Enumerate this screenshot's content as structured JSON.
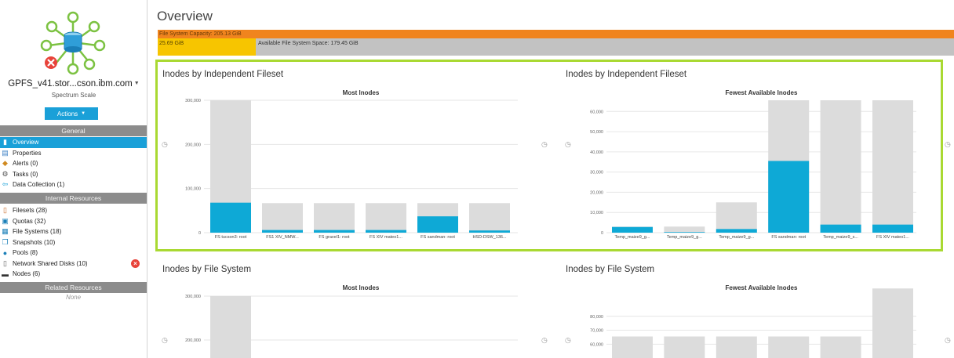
{
  "sidebar": {
    "fs_name": "GPFS_v41.stor...cson.ibm.com",
    "fs_type": "Spectrum Scale",
    "actions_label": "Actions",
    "general_header": "General",
    "general_items": [
      {
        "label": "Overview",
        "icon": "overview-icon"
      },
      {
        "label": "Properties",
        "icon": "properties-icon"
      },
      {
        "label": "Alerts (0)",
        "icon": "alerts-icon"
      },
      {
        "label": "Tasks (0)",
        "icon": "tasks-icon"
      },
      {
        "label": "Data Collection (1)",
        "icon": "data-collection-icon"
      }
    ],
    "internal_header": "Internal Resources",
    "internal_items": [
      {
        "label": "Filesets (28)",
        "icon": "filesets-icon"
      },
      {
        "label": "Quotas (32)",
        "icon": "quotas-icon"
      },
      {
        "label": "File Systems (18)",
        "icon": "file-systems-icon"
      },
      {
        "label": "Snapshots (10)",
        "icon": "snapshots-icon"
      },
      {
        "label": "Pools (8)",
        "icon": "pools-icon"
      },
      {
        "label": "Network Shared Disks (10)",
        "icon": "nsd-icon"
      },
      {
        "label": "Nodes (6)",
        "icon": "nodes-icon"
      }
    ],
    "related_header": "Related Resources",
    "related_none": "None"
  },
  "main": {
    "title": "Overview",
    "capacity_label": "File System Capacity: 205.13 GiB",
    "used_label": "25.69 GiB",
    "available_label": "Available File System Space: 179.45 GiB"
  },
  "colors": {
    "accent": "#1aa0d8",
    "capacity": "#f0841e",
    "used": "#f7c500",
    "available": "#c2c2c2",
    "highlight": "#a9d932",
    "bar_total": "#dcdcdc",
    "bar_used": "#0ea9d6"
  },
  "chart_titles": {
    "c1": "Inodes by Independent Fileset",
    "c2": "Inodes by Independent Fileset",
    "c3": "Inodes by File System",
    "c4": "Inodes by File System"
  },
  "chart_data": [
    {
      "id": "c1",
      "type": "bar",
      "title": "Most Inodes",
      "ylim": [
        0,
        300000
      ],
      "yticks": [
        "0",
        "100,000",
        "200,000",
        "300,000"
      ],
      "categories": [
        "FS tucson3: root",
        "FS1 XIV_NMW...",
        "FS gravel1: root",
        "FS XIV mateo1...",
        "FS sandman: root",
        "HSD-DSW_136..."
      ],
      "series": [
        {
          "values": [
            300000,
            67000,
            67000,
            67000,
            67000,
            67000
          ]
        },
        {
          "values": [
            68000,
            6000,
            6000,
            6000,
            37000,
            5000
          ]
        }
      ]
    },
    {
      "id": "c2",
      "type": "bar",
      "title": "Fewest Available Inodes",
      "ylim": [
        0,
        65536
      ],
      "yticks": [
        "0",
        "10,000",
        "20,000",
        "30,000",
        "40,000",
        "50,000",
        "60,000"
      ],
      "categories": [
        "Temp_maize9_g...",
        "Temp_maize9_g...",
        "Temp_maize9_g...",
        "FS sandman: root",
        "Temp_maize9_s...",
        "FS XIV mateo1..."
      ],
      "series": [
        {
          "values": [
            3000,
            3000,
            15000,
            65536,
            65536,
            65536
          ]
        },
        {
          "values": [
            2800,
            300,
            1800,
            35500,
            4000,
            4000
          ]
        }
      ]
    },
    {
      "id": "c3",
      "type": "bar",
      "title": "Most Inodes",
      "ylim": [
        0,
        300000
      ],
      "yticks": [
        "200,000",
        "300,000"
      ],
      "categories": [],
      "series": [
        {
          "values": [
            300000
          ]
        }
      ]
    },
    {
      "id": "c4",
      "type": "bar",
      "title": "Fewest Available Inodes",
      "ylim": [
        0,
        100000
      ],
      "yticks": [
        "50,000",
        "60,000",
        "70,000",
        "80,000"
      ],
      "categories": [],
      "series": [
        {
          "values": [
            65536,
            65536,
            65536,
            65536,
            65536,
            100000
          ]
        }
      ]
    }
  ]
}
